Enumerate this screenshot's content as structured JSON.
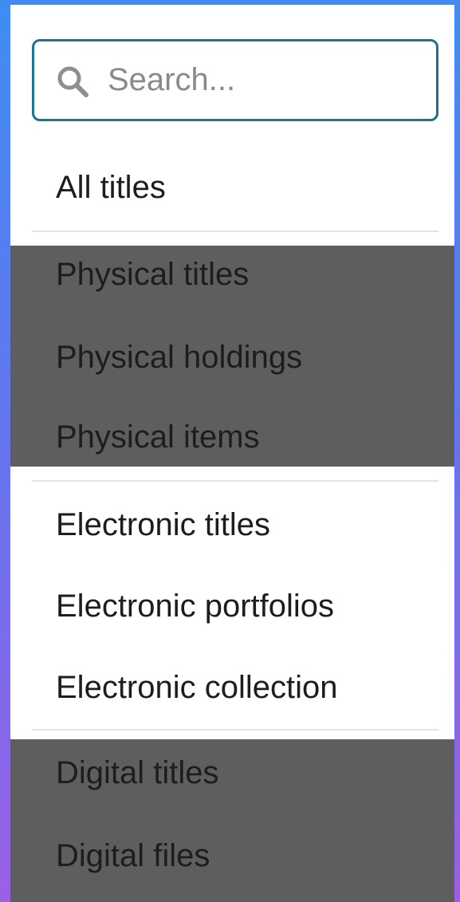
{
  "search": {
    "placeholder": "Search..."
  },
  "menu": {
    "all": "All titles",
    "physical": [
      "Physical titles",
      "Physical holdings",
      "Physical items"
    ],
    "electronic": [
      "Electronic titles",
      "Electronic portfolios",
      "Electronic collection"
    ],
    "digital": [
      "Digital titles",
      "Digital files"
    ]
  },
  "colors": {
    "search_border": "#1b7490",
    "highlight_group": "#5e5e5e",
    "text": "#1d1d1d",
    "divider": "#e3e3e3"
  },
  "icons": {
    "search": "search-icon"
  }
}
